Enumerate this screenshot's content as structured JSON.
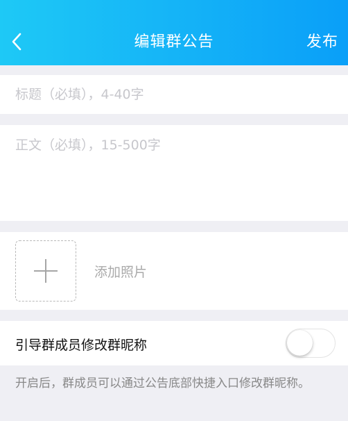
{
  "header": {
    "title": "编辑群公告",
    "back_icon": "chevron-left-icon",
    "publish_label": "发布",
    "gradient_start": "#1ec9f6",
    "gradient_end": "#0a9ff8"
  },
  "form": {
    "title_placeholder": "标题（必填），4-40字",
    "title_value": "",
    "body_placeholder": "正文（必填），15-500字",
    "body_value": ""
  },
  "photo": {
    "add_icon": "plus-icon",
    "add_label": "添加照片"
  },
  "nickname_guide": {
    "label": "引导群成员修改群昵称",
    "enabled": false,
    "hint": "开启后，群成员可以通过公告底部快捷入口修改群昵称。"
  }
}
